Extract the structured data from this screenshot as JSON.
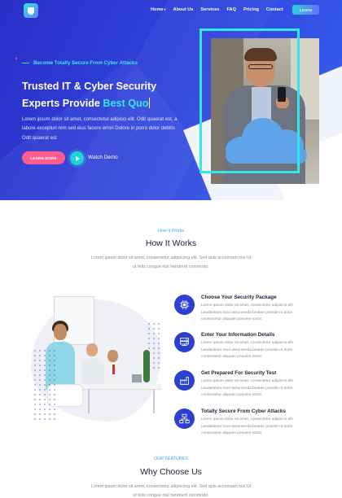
{
  "header": {
    "nav": [
      {
        "label": "Home",
        "has_caret": true
      },
      {
        "label": "About Us"
      },
      {
        "label": "Services"
      },
      {
        "label": "FAQ"
      },
      {
        "label": "Pricing"
      },
      {
        "label": "Contact"
      }
    ],
    "caret": "▾",
    "login_label": "LOGIN"
  },
  "hero": {
    "tagline": "Become Totally Secure From Cyber Attacks",
    "title_line1": "Trusted IT & Cyber Security",
    "title_line2_prefix": "Experts Provide",
    "title_highlight": "Best Quo",
    "paragraph": "Lorem ipsum dolor sit amet, consectetur adipisci elit. Odit quaerat est, a labore excepturi rem sed eius facere errori Dolore in porro dolor debitis Odit quaerat est",
    "learn_more_label": "LEARN MORE",
    "watch_demo_label": "Watch Demo"
  },
  "how_it_works": {
    "label": "How It Works",
    "title": "How It Works",
    "description": "Lorem ipsum dolor sit amet, consectetur adipiscing elit. Sed quis accumsan nisi Ut ut felis congue nisl hendrerit commodo.",
    "steps": [
      {
        "icon": "cpu-icon",
        "title": "Choose Your Security Package",
        "desc": "Lorem ipsum dolor sit amet, consectetur adipiscin elit. Laudantium mod assumenda beatae provide nt dolor consectetur aliquam posuere tortor."
      },
      {
        "icon": "server-icon",
        "title": "Enter Your Information Details",
        "desc": "Lorem ipsum dolor sit amet, consectetur adipiscin elit. Laudantium mod assumenda beatae provide nt dolor consectetur aliquam posuere tortor."
      },
      {
        "icon": "factory-icon",
        "title": "Get Prepared For Security Test",
        "desc": "Lorem ipsum dolor sit amet, consectetur adipiscin elit. Laudantium mod assumenda beatae provide nt dolor consectetur aliquam posuere tortor."
      },
      {
        "icon": "network-icon",
        "title": "Totally Secure From Cyber Attacks",
        "desc": "Lorem ipsum dolor sit amet, consectetur adipiscin elit. Laudantium mod assumenda beatae provide nt dolor consectetur aliquam posuere tortor."
      }
    ]
  },
  "features": {
    "label": "OUR FEATURES",
    "title": "Why Choose Us",
    "description": "Lorem ipsum dolor sit amet, consectetur adipiscing elit. Sed quis accumsan nisi Ut ut felis congue nisl hendrerit commodo."
  },
  "colors": {
    "hero_blue": "#2f46de",
    "accent_cyan": "#35e6ef",
    "pink": "#ff5d8e",
    "icon_blue": "#2b3fd0"
  }
}
